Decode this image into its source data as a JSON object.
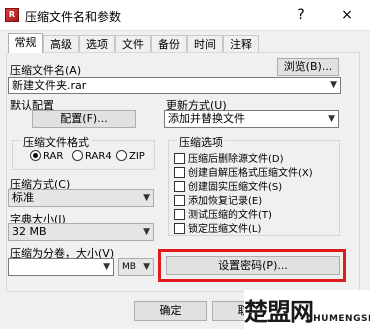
{
  "window": {
    "title": "压缩文件名和参数",
    "help_icon": "?",
    "close_icon": "×"
  },
  "tabs": [
    "常规",
    "高级",
    "选项",
    "文件",
    "备份",
    "时间",
    "注释"
  ],
  "archive_name": {
    "label": "压缩文件名(A)",
    "value": "新建文件夹.rar",
    "browse_label": "浏览(B)..."
  },
  "default_profile": {
    "label": "默认配置",
    "button_label": "配置(F)..."
  },
  "update_mode": {
    "label": "更新方式(U)",
    "value": "添加并替换文件"
  },
  "archive_format": {
    "label": "压缩文件格式",
    "options": [
      "RAR",
      "RAR4",
      "ZIP"
    ],
    "selected": "RAR"
  },
  "compression_method": {
    "label": "压缩方式(C)",
    "value": "标准"
  },
  "dictionary_size": {
    "label": "字典大小(I)",
    "value": "32 MB"
  },
  "split_volume": {
    "label": "压缩为分卷，大小(V)",
    "value": "",
    "unit": "MB"
  },
  "archiving_options": {
    "label": "压缩选项",
    "items": [
      "压缩后删除源文件(D)",
      "创建自解压格式压缩文件(X)",
      "创建固实压缩文件(S)",
      "添加恢复记录(E)",
      "测试压缩的文件(T)",
      "锁定压缩文件(L)"
    ]
  },
  "set_password": {
    "label": "设置密码(P)..."
  },
  "bottom_buttons": {
    "ok": "确定",
    "cancel": "取消"
  },
  "watermark": {
    "logo_text": "楚盟网",
    "text": "CHUMENGSI"
  },
  "colors": {
    "highlight": "#e01b1b"
  }
}
